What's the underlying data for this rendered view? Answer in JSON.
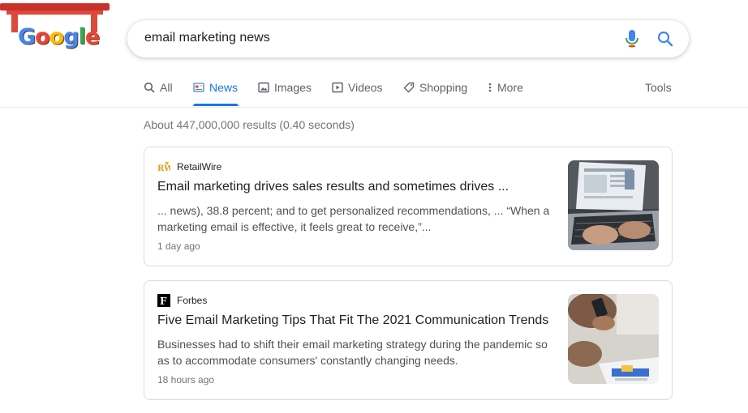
{
  "logo": {
    "text": "Google"
  },
  "search": {
    "query": "email marketing news"
  },
  "tabs": [
    {
      "label": "All",
      "icon": "search-icon"
    },
    {
      "label": "News",
      "icon": "news-icon",
      "active": true
    },
    {
      "label": "Images",
      "icon": "image-icon"
    },
    {
      "label": "Videos",
      "icon": "video-icon"
    },
    {
      "label": "Shopping",
      "icon": "tag-icon"
    },
    {
      "label": "More",
      "icon": "more-vert-icon"
    }
  ],
  "tools_label": "Tools",
  "stats": "About 447,000,000 results (0.40 seconds)",
  "results": [
    {
      "source": "RetailWire",
      "title": "Email marketing drives sales results and sometimes drives ...",
      "snippet": "... news), 38.8 percent; and to get personalized recommendations, ... “When a marketing email is effective, it feels great to receive,”...",
      "age": "1 day ago"
    },
    {
      "source": "Forbes",
      "title": "Five Email Marketing Tips That Fit The 2021 Communication Trends",
      "snippet": "Businesses had to shift their email marketing strategy during the pandemic so as to accommodate consumers' constantly changing needs.",
      "age": "18 hours ago"
    }
  ],
  "colors": {
    "accent": "#1a73e8",
    "text_secondary": "#5f6368",
    "border": "#dadce0"
  }
}
